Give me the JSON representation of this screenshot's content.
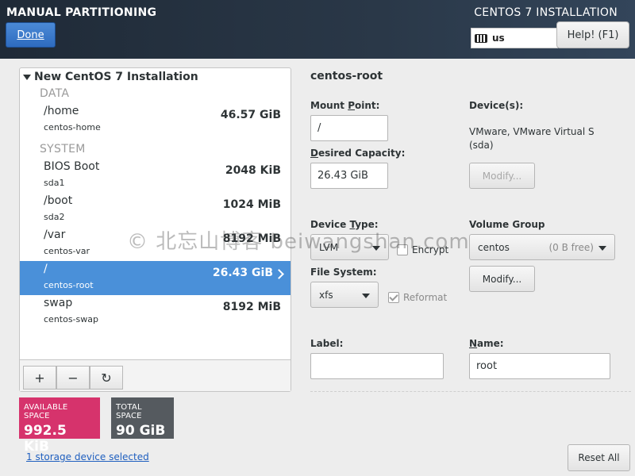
{
  "header": {
    "app_title": "MANUAL PARTITIONING",
    "install_title": "CENTOS 7 INSTALLATION",
    "done_label": "Done",
    "keyboard_layout": "us",
    "help_label": "Help! (F1)"
  },
  "tree": {
    "title": "New CentOS 7 Installation",
    "groups": [
      {
        "label": "DATA"
      },
      {
        "label": "SYSTEM"
      }
    ],
    "mounts": [
      {
        "name": "/home",
        "device": "centos-home",
        "size": "46.57 GiB"
      },
      {
        "name": "BIOS Boot",
        "device": "sda1",
        "size": "2048 KiB"
      },
      {
        "name": "/boot",
        "device": "sda2",
        "size": "1024 MiB"
      },
      {
        "name": "/var",
        "device": "centos-var",
        "size": "8192 MiB"
      },
      {
        "name": "/",
        "device": "centos-root",
        "size": "26.43 GiB",
        "selected": true
      },
      {
        "name": "swap",
        "device": "centos-swap",
        "size": "8192 MiB"
      }
    ],
    "toolbar": {
      "add": "+",
      "remove": "−",
      "refresh": "↻"
    }
  },
  "space": {
    "available_label": "AVAILABLE SPACE",
    "available_value": "992.5 KiB",
    "total_label": "TOTAL SPACE",
    "total_value": "90 GiB"
  },
  "storage_link": "1 storage device selected",
  "detail": {
    "title": "centos-root",
    "mount_point_label_pre": "Mount ",
    "mount_point_label_u": "P",
    "mount_point_label_post": "oint:",
    "mount_point_value": "/",
    "capacity_label_u": "D",
    "capacity_label_post": "esired Capacity:",
    "capacity_value": "26.43 GiB",
    "devices_label": "Device(s):",
    "devices_text": "VMware, VMware Virtual S (sda)",
    "modify_devices_label": "Modify...",
    "device_type_label_pre": "Device ",
    "device_type_label_u": "T",
    "device_type_label_post": "ype:",
    "device_type_value": "LVM",
    "encrypt_label": "Encrypt",
    "volume_group_label": "Volume Group",
    "volume_group_value": "centos",
    "volume_group_free": "(0 B free)",
    "modify_vg_label": "Modify...",
    "filesystem_label": "File System:",
    "filesystem_value": "xfs",
    "reformat_label": "Reformat",
    "label_label": "Label:",
    "label_value": "",
    "name_label_u": "N",
    "name_label_post": "ame:",
    "name_value": "root"
  },
  "reset_label": "Reset All",
  "watermark": "© 北忘山博客 beiwangshan.com",
  "colors": {
    "header_bg": "#24303f",
    "selected_row": "#4a90d9",
    "available_space": "#d6336c",
    "total_space": "#555a5f",
    "done_button": "#2e6bbf"
  }
}
